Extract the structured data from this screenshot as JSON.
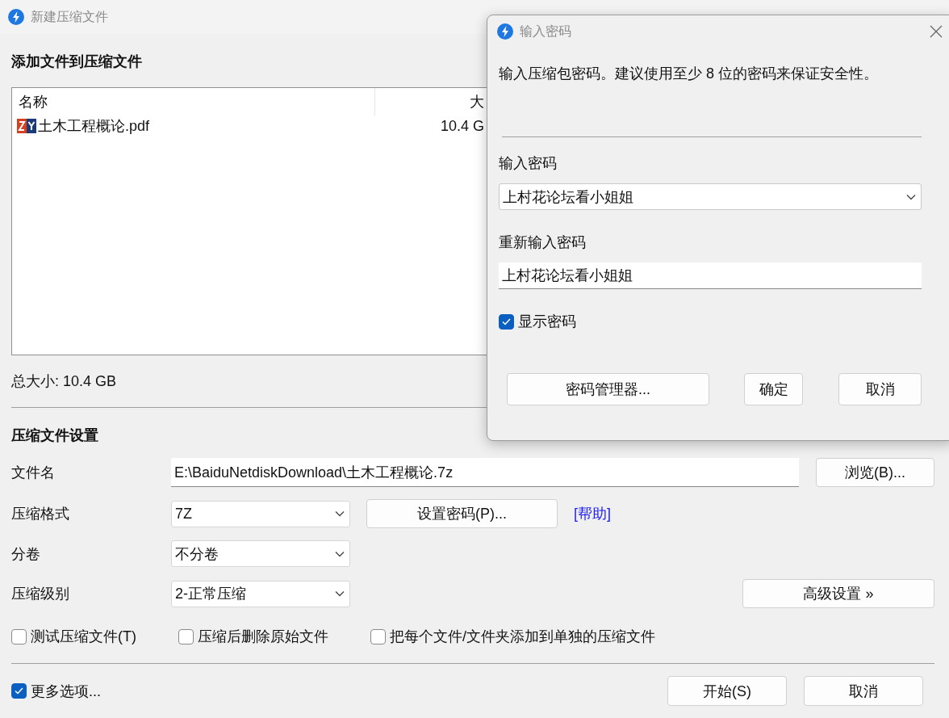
{
  "window": {
    "title": "新建压缩文件"
  },
  "files_section": {
    "heading": "添加文件到压缩文件",
    "columns": [
      "名称",
      "大"
    ],
    "rows": [
      {
        "name": "土木工程概论.pdf",
        "size": "10.4 G"
      }
    ],
    "total": "总大小: 10.4 GB"
  },
  "settings": {
    "heading": "压缩文件设置",
    "filename": {
      "label": "文件名",
      "value": "E:\\BaiduNetdiskDownload\\土木工程概论.7z"
    },
    "browse_button": "浏览(B)...",
    "format": {
      "label": "压缩格式",
      "value": "7Z"
    },
    "password_button": "设置密码(P)...",
    "help_link": "[帮助]",
    "split": {
      "label": "分卷",
      "value": "不分卷"
    },
    "level": {
      "label": "压缩级别",
      "value": "2-正常压缩"
    },
    "advanced_button": "高级设置 »",
    "options": [
      {
        "label": "测试压缩文件(T)",
        "checked": false
      },
      {
        "label": "压缩后删除原始文件",
        "checked": false
      },
      {
        "label": "把每个文件/文件夹添加到单独的压缩文件",
        "checked": false
      }
    ]
  },
  "more_options": {
    "label": "更多选项...",
    "checked": true
  },
  "buttons": [
    "开始(S)",
    "取消"
  ],
  "password_dialog": {
    "title": "输入密码",
    "description": "输入压缩包密码。建议使用至少 8 位的密码来保证安全性。",
    "password": {
      "label": "输入密码",
      "value": "上村花论坛看小姐姐"
    },
    "confirm": {
      "label": "重新输入密码",
      "value": "上村花论坛看小姐姐"
    },
    "show_password": {
      "label": "显示密码",
      "checked": true
    },
    "buttons": [
      "密码管理器...",
      "确定",
      "取消"
    ]
  }
}
